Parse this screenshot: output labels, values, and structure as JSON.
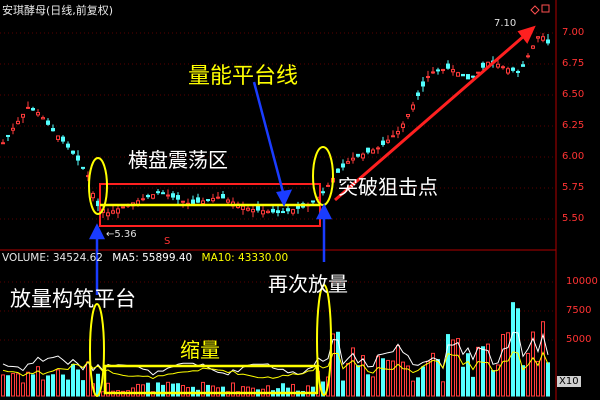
{
  "header": {
    "title": "安琪酵母(日线,前复权)",
    "volume_label": "VOLUME: 34524.62",
    "ma5_label": "MA5: 55899.40",
    "ma10_label": "MA10: 43330.00"
  },
  "annotations": {
    "platform_line": "量能平台线",
    "consolidation": "横盘震荡区",
    "breakout": "突破狙击点",
    "volume_platform": "放量构筑平台",
    "shrink": "缩量",
    "volume_again": "再次放量",
    "low_label": "←5.36",
    "high_label": "7.10",
    "s_marker": "S"
  },
  "axes": {
    "price_ticks": [
      "7.00",
      "6.75",
      "6.50",
      "6.25",
      "6.00",
      "5.75",
      "5.50"
    ],
    "volume_ticks": [
      "10000",
      "7500",
      "5000"
    ],
    "volume_unit": "X10"
  },
  "colors": {
    "background": "#000000",
    "up": "#ff3b3b",
    "down": "#54ffff",
    "box_red": "#ff2020",
    "box_yellow": "#ffff00",
    "arrow_blue": "#1a3cff",
    "ma5": "#ffffff",
    "ma10": "#ffff00"
  },
  "chart_data": {
    "type": "candlestick",
    "ylim": [
      5.3,
      7.15
    ],
    "volume_ylim": [
      0,
      12000
    ],
    "low_point": 5.36,
    "high_point": 7.1,
    "consolidation_range": [
      5.45,
      5.78
    ],
    "platform_line_value": 5.62
  }
}
